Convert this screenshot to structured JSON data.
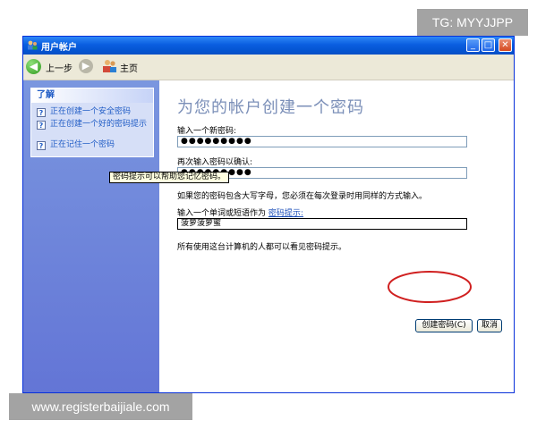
{
  "overlay": {
    "tg_badge": "TG: MYYJJPP",
    "watermark": "www.registerbaijiale.com"
  },
  "window": {
    "title": "用户帐户"
  },
  "navbar": {
    "back_label": "上一步",
    "home_label": "主页"
  },
  "sidebar": {
    "panel_title": "了解",
    "help_items": [
      {
        "label": "正在创建一个安全密码",
        "icon": "help-icon"
      },
      {
        "label": "正在创建一个好的密码提示",
        "icon": "help-icon"
      },
      {
        "label": "正在记住一个密码",
        "icon": "help-icon"
      }
    ]
  },
  "main": {
    "heading": "为您的帐户创建一个密码",
    "new_password_label": "输入一个新密码:",
    "new_password_value": "●●●●●●●●●",
    "confirm_label": "再次输入密码以确认:",
    "confirm_value": "●●●●●●●●●",
    "case_note": "如果您的密码包含大写字母，您必须在每次登录时用同样的方式输入。",
    "hint_label": "输入一个单词或短语作为",
    "hint_link": "密码提示:",
    "hint_value": "菠萝菠萝蜜",
    "hint_tooltip": "密码提示可以帮助您记忆密码。",
    "visibility_note": "所有使用这台计算机的人都可以看见密码提示。",
    "create_button": "创建密码(C)",
    "cancel_button": "取消"
  },
  "colors": {
    "title_bar": "#0a5ee0",
    "sidebar": "#6f87dc",
    "heading": "#7b8fb8",
    "annotation": "#d02020"
  }
}
